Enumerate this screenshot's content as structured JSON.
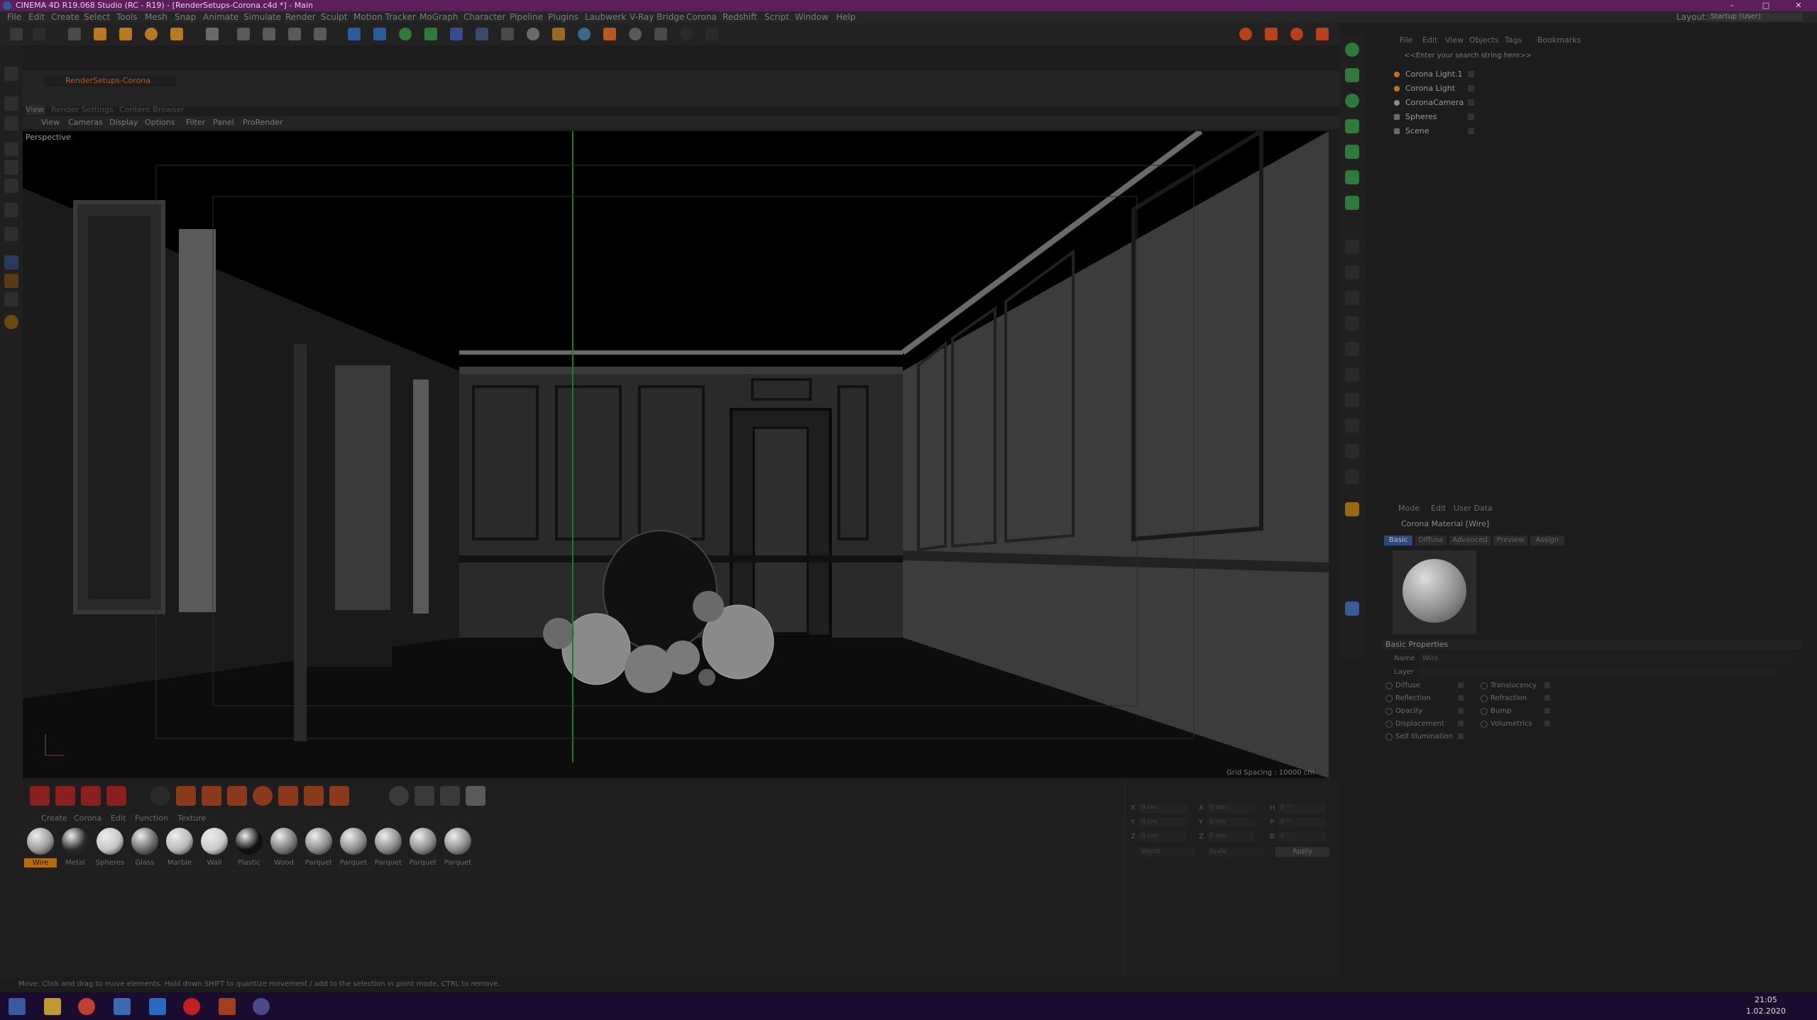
{
  "window": {
    "title": "CINEMA 4D R19.068 Studio (RC - R19) - [RenderSetups-Corona.c4d *] - Main",
    "minimize": "–",
    "maximize": "□",
    "close": "✕"
  },
  "menu": [
    "File",
    "Edit",
    "Create",
    "Select",
    "Tools",
    "Mesh",
    "Snap",
    "Animate",
    "Simulate",
    "Render",
    "Sculpt",
    "Motion Tracker",
    "MoGraph",
    "Character",
    "Pipeline",
    "Plugins",
    "Laubwerk",
    "V-Ray Bridge",
    "Corona",
    "Redshift",
    "Script",
    "Window",
    "Help"
  ],
  "layout": {
    "label": "Layout:",
    "value": "Startup (User)"
  },
  "document_tab": "RenderSetups-Corona",
  "view_tabs": [
    "View",
    "Render Settings",
    "Content Browser"
  ],
  "viewport_menu": [
    "View",
    "Cameras",
    "Display",
    "Options",
    "Filter",
    "Panel",
    "ProRender"
  ],
  "viewport": {
    "camera_label": "Perspective",
    "grid_spacing": "Grid Spacing : 10000 cm"
  },
  "material_menu": [
    "Create",
    "Corona",
    "Edit",
    "Function",
    "Texture"
  ],
  "materials": [
    {
      "name": "Wire",
      "selected": true,
      "tone": "#9a9a9a"
    },
    {
      "name": "Metal",
      "selected": false,
      "tone": "#2b2b2b"
    },
    {
      "name": "Spheres",
      "selected": false,
      "tone": "#c4c4c4"
    },
    {
      "name": "Glass",
      "selected": false,
      "tone": "#6a6a6a"
    },
    {
      "name": "Marble",
      "selected": false,
      "tone": "#b8b8b8"
    },
    {
      "name": "Wall",
      "selected": false,
      "tone": "#c8c8c8"
    },
    {
      "name": "Plastic",
      "selected": false,
      "tone": "#101010"
    },
    {
      "name": "Wood",
      "selected": false,
      "tone": "#7a7a7a"
    },
    {
      "name": "Parquet",
      "selected": false,
      "tone": "#8a8a8a"
    },
    {
      "name": "Parquet",
      "selected": false,
      "tone": "#8a8a8a"
    },
    {
      "name": "Parquet",
      "selected": false,
      "tone": "#8a8a8a"
    },
    {
      "name": "Parquet",
      "selected": false,
      "tone": "#8a8a8a"
    },
    {
      "name": "Parquet",
      "selected": false,
      "tone": "#8a8a8a"
    }
  ],
  "coordinates": {
    "rows": [
      {
        "a": "X",
        "av": "0 cm",
        "b": "X",
        "bv": "0 cm",
        "c": "H",
        "cv": "0 °"
      },
      {
        "a": "Y",
        "av": "0 cm",
        "b": "Y",
        "bv": "0 cm",
        "c": "P",
        "cv": "0 °"
      },
      {
        "a": "Z",
        "av": "0 cm",
        "b": "Z",
        "bv": "0 cm",
        "c": "B",
        "cv": "0 °"
      }
    ],
    "mode_left": "World",
    "mode_right": "Scale",
    "apply": "Apply"
  },
  "status": "Move: Click and drag to move elements. Hold down SHIFT to quantize movement / add to the selection in point mode, CTRL to remove.",
  "object_manager": {
    "menu": [
      "File",
      "Edit",
      "View",
      "Objects",
      "Tags",
      "Bookmarks"
    ],
    "search_placeholder": "<<Enter your search string here>>",
    "objects": [
      {
        "name": "Corona Light.1",
        "color": "#c07020"
      },
      {
        "name": "Corona Light",
        "color": "#c07020"
      },
      {
        "name": "CoronaCamera",
        "color": "#8a8a8a"
      },
      {
        "name": "Spheres",
        "color": "#8a8a8a"
      },
      {
        "name": "Scene",
        "color": "#8a8a8a"
      }
    ]
  },
  "attributes": {
    "menu": [
      "Mode",
      "Edit",
      "User Data"
    ],
    "title": "Corona Material [Wire]",
    "tabs": [
      "Basic",
      "Diffuse",
      "Advanced",
      "Preview",
      "Assign"
    ],
    "section": "Basic Properties",
    "name_label": "Name",
    "name_value": "Wire",
    "layer_label": "Layer",
    "channels_left": [
      "Diffuse",
      "Reflection",
      "Opacity",
      "Displacement",
      "Self Illumination"
    ],
    "channels_right": [
      "Translucency",
      "Refraction",
      "Bump",
      "Volumetrics"
    ]
  },
  "taskbar": {
    "time": "21:05",
    "date": "1.02.2020"
  }
}
